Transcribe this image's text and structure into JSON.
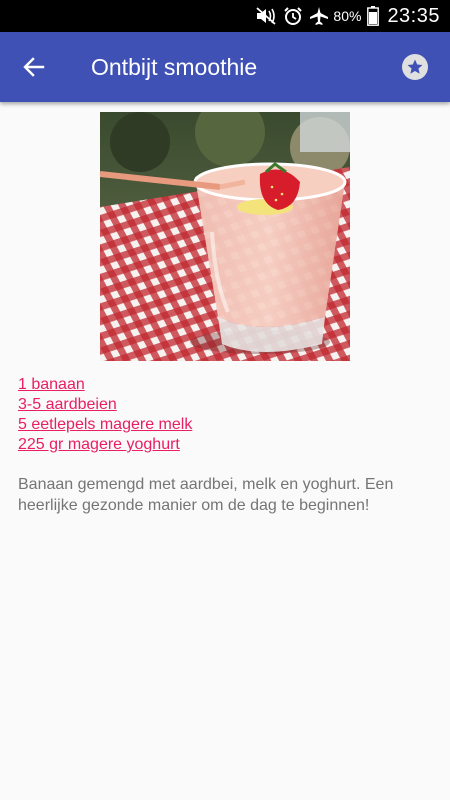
{
  "status_bar": {
    "battery": "80%",
    "time": "23:35",
    "icons": [
      "mute-icon",
      "alarm-icon",
      "airplane-icon",
      "battery-icon"
    ]
  },
  "app_bar": {
    "title": "Ontbijt smoothie",
    "back_icon": "arrow-back-icon",
    "favorite_icon": "star-icon",
    "color": "#3f51b5"
  },
  "recipe": {
    "image": "smoothie-photo",
    "ingredients": [
      "1 banaan",
      "3-5 aardbeien",
      "5 eetlepels magere melk",
      "225 gr magere yoghurt"
    ],
    "description": "Banaan gemengd met aardbei, melk en yoghurt. Een heerlijke gezonde manier om de dag te beginnen!",
    "link_color": "#e91e63"
  }
}
